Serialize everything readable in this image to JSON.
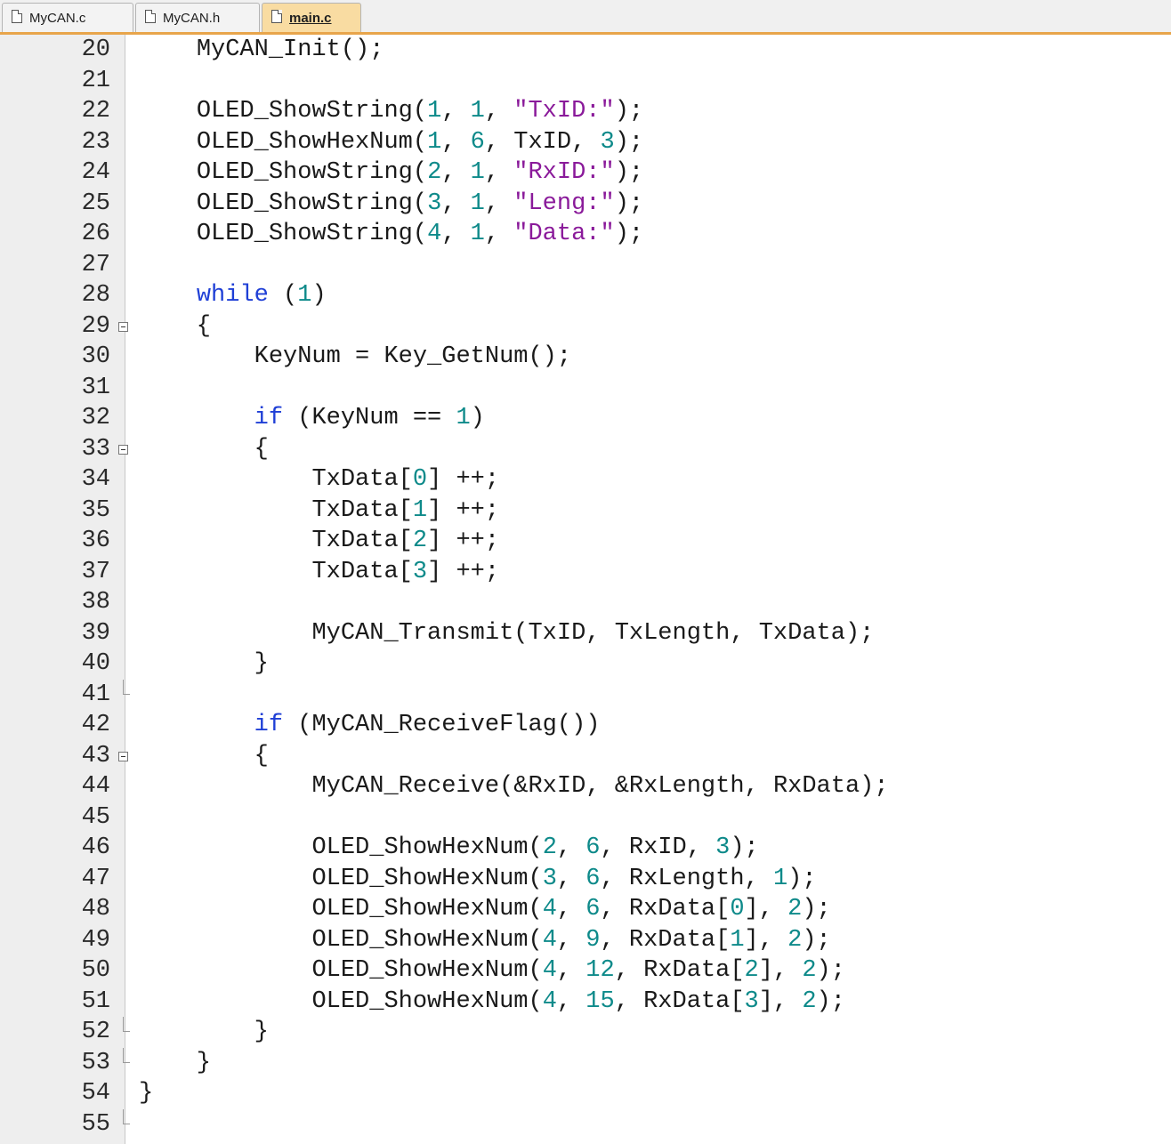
{
  "tabs": [
    {
      "label": "MyCAN.c",
      "active": false
    },
    {
      "label": "MyCAN.h",
      "active": false
    },
    {
      "label": "main.c",
      "active": true
    }
  ],
  "colors": {
    "keyword": "#1f3fd6",
    "number": "#0e8a8a",
    "string": "#8a1a9a",
    "tab_accent": "#e8a54b"
  },
  "icons": {
    "tab": "document-icon",
    "fold": "fold-minus-icon"
  },
  "code": {
    "lines": [
      {
        "n": "20",
        "text": "    MyCAN_Init();"
      },
      {
        "n": "21",
        "text": ""
      },
      {
        "n": "22",
        "text": "    OLED_ShowString(1, 1, \"TxID:\");"
      },
      {
        "n": "23",
        "text": "    OLED_ShowHexNum(1, 6, TxID, 3);"
      },
      {
        "n": "24",
        "text": "    OLED_ShowString(2, 1, \"RxID:\");"
      },
      {
        "n": "25",
        "text": "    OLED_ShowString(3, 1, \"Leng:\");"
      },
      {
        "n": "26",
        "text": "    OLED_ShowString(4, 1, \"Data:\");"
      },
      {
        "n": "27",
        "text": ""
      },
      {
        "n": "28",
        "text": "    while (1)"
      },
      {
        "n": "29",
        "text": "    {",
        "fold": "open"
      },
      {
        "n": "30",
        "text": "        KeyNum = Key_GetNum();"
      },
      {
        "n": "31",
        "text": ""
      },
      {
        "n": "32",
        "text": "        if (KeyNum == 1)"
      },
      {
        "n": "33",
        "text": "        {",
        "fold": "open"
      },
      {
        "n": "34",
        "text": "            TxData[0] ++;"
      },
      {
        "n": "35",
        "text": "            TxData[1] ++;"
      },
      {
        "n": "36",
        "text": "            TxData[2] ++;"
      },
      {
        "n": "37",
        "text": "            TxData[3] ++;"
      },
      {
        "n": "38",
        "text": ""
      },
      {
        "n": "39",
        "text": "            MyCAN_Transmit(TxID, TxLength, TxData);"
      },
      {
        "n": "40",
        "text": "        }"
      },
      {
        "n": "41",
        "text": "",
        "fold": "end"
      },
      {
        "n": "42",
        "text": "        if (MyCAN_ReceiveFlag())"
      },
      {
        "n": "43",
        "text": "        {",
        "fold": "open"
      },
      {
        "n": "44",
        "text": "            MyCAN_Receive(&RxID, &RxLength, RxData);"
      },
      {
        "n": "45",
        "text": ""
      },
      {
        "n": "46",
        "text": "            OLED_ShowHexNum(2, 6, RxID, 3);"
      },
      {
        "n": "47",
        "text": "            OLED_ShowHexNum(3, 6, RxLength, 1);"
      },
      {
        "n": "48",
        "text": "            OLED_ShowHexNum(4, 6, RxData[0], 2);"
      },
      {
        "n": "49",
        "text": "            OLED_ShowHexNum(4, 9, RxData[1], 2);"
      },
      {
        "n": "50",
        "text": "            OLED_ShowHexNum(4, 12, RxData[2], 2);"
      },
      {
        "n": "51",
        "text": "            OLED_ShowHexNum(4, 15, RxData[3], 2);"
      },
      {
        "n": "52",
        "text": "        }",
        "fold": "end"
      },
      {
        "n": "53",
        "text": "    }",
        "fold": "end"
      },
      {
        "n": "54",
        "text": "}"
      },
      {
        "n": "55",
        "text": "",
        "fold": "end"
      }
    ]
  }
}
